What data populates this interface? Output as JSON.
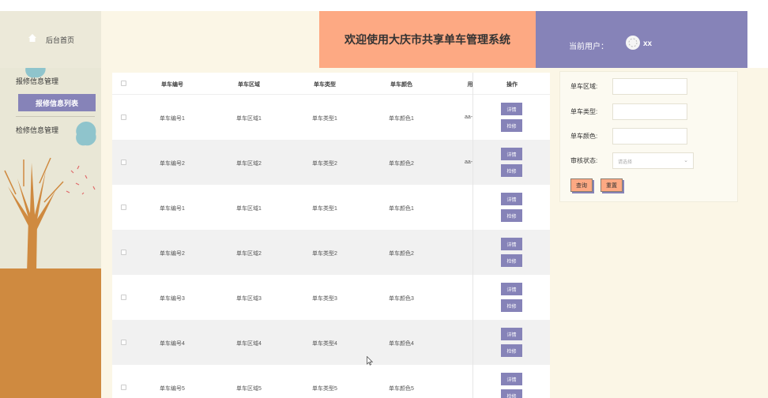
{
  "header": {
    "home_label": "后台首页",
    "title": "欢迎使用大庆市共享单车管理系统",
    "user_label": "当前用户：",
    "user_name": "xx"
  },
  "sidebar": {
    "menu1": "报修信息管理",
    "menu1_sub": "报修信息列表",
    "menu2": "检修信息管理"
  },
  "table": {
    "headers": [
      "单车编号",
      "单车区域",
      "单车类型",
      "单车颜色",
      "用",
      "操作"
    ],
    "rows": [
      {
        "no": "单车编号1",
        "area": "单车区域1",
        "type": "单车类型1",
        "color": "单车颜色1",
        "user": "aa-"
      },
      {
        "no": "单车编号2",
        "area": "单车区域2",
        "type": "单车类型2",
        "color": "单车颜色2",
        "user": "aa-"
      },
      {
        "no": "单车编号1",
        "area": "单车区域1",
        "type": "单车类型1",
        "color": "单车颜色1",
        "user": ""
      },
      {
        "no": "单车编号2",
        "area": "单车区域2",
        "type": "单车类型2",
        "color": "单车颜色2",
        "user": ""
      },
      {
        "no": "单车编号3",
        "area": "单车区域3",
        "type": "单车类型3",
        "color": "单车颜色3",
        "user": ""
      },
      {
        "no": "单车编号4",
        "area": "单车区域4",
        "type": "单车类型4",
        "color": "单车颜色4",
        "user": ""
      },
      {
        "no": "单车编号5",
        "area": "单车区域5",
        "type": "单车类型5",
        "color": "单车颜色5",
        "user": ""
      }
    ],
    "detail_label": "详情",
    "repair_label": "检修"
  },
  "search": {
    "area_label": "单车区域:",
    "type_label": "单车类型:",
    "color_label": "单车颜色:",
    "status_label": "审核状态:",
    "status_placeholder": "请选择",
    "query_button": "查询",
    "reset_button": "重置"
  },
  "colors": {
    "accent_purple": "#8683b8",
    "accent_orange": "#fda983",
    "cream": "#fbf6e6"
  },
  "icons": [
    "home-icon",
    "avatar-icon",
    "chevron-down-icon",
    "mouse-cursor-icon"
  ]
}
